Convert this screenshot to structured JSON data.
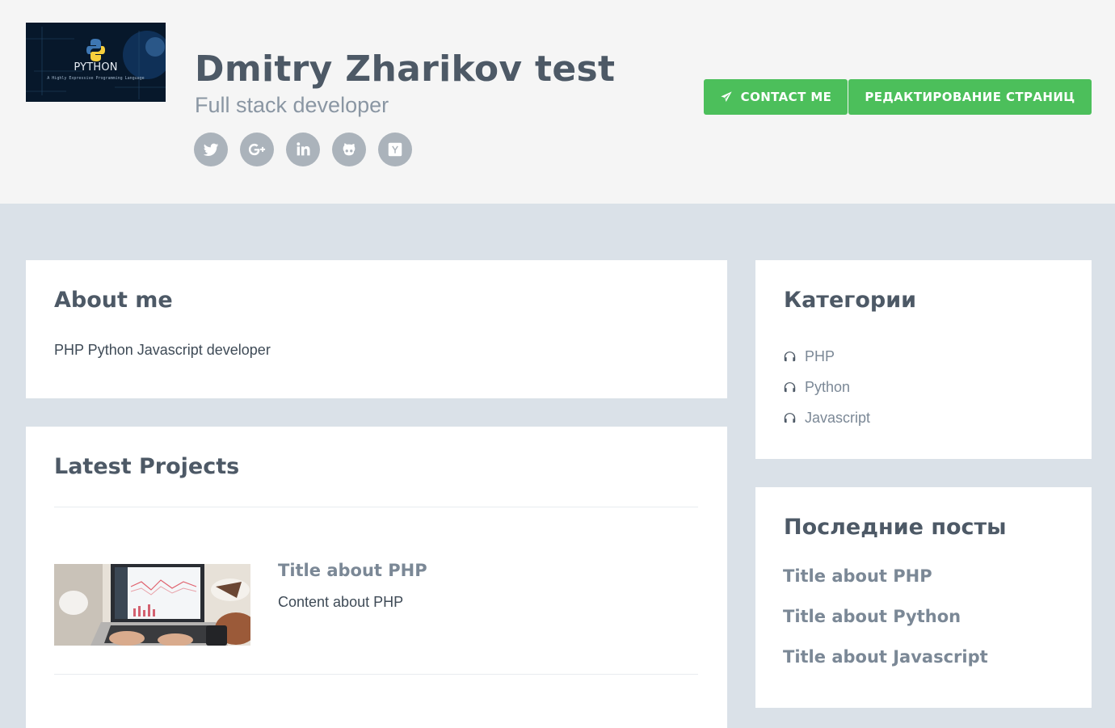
{
  "header": {
    "logo": {
      "text": "PYTHON",
      "subtext": "A Highly Expressive Programming Language"
    },
    "name": "Dmitry Zharikov test",
    "tagline": "Full stack developer",
    "socials": [
      {
        "icon": "twitter-icon"
      },
      {
        "icon": "google-plus-icon"
      },
      {
        "icon": "linkedin-icon"
      },
      {
        "icon": "github-icon"
      },
      {
        "icon": "hacker-news-icon"
      }
    ],
    "contact_label": "CONTACT ME",
    "edit_label": "РЕДАКТИРОВАНИЕ СТРАНИЦ",
    "button_color": "#4cbf5b"
  },
  "about": {
    "title": "About me",
    "text": "PHP Python Javascript developer"
  },
  "projects": {
    "title": "Latest Projects",
    "items": [
      {
        "title": "Title about PHP",
        "content": "Content about PHP"
      }
    ]
  },
  "categories": {
    "title": "Категории",
    "items": [
      "PHP",
      "Python",
      "Javascript"
    ]
  },
  "posts": {
    "title": "Последние посты",
    "items": [
      "Title about PHP",
      "Title about Python",
      "Title about Javascript"
    ]
  }
}
